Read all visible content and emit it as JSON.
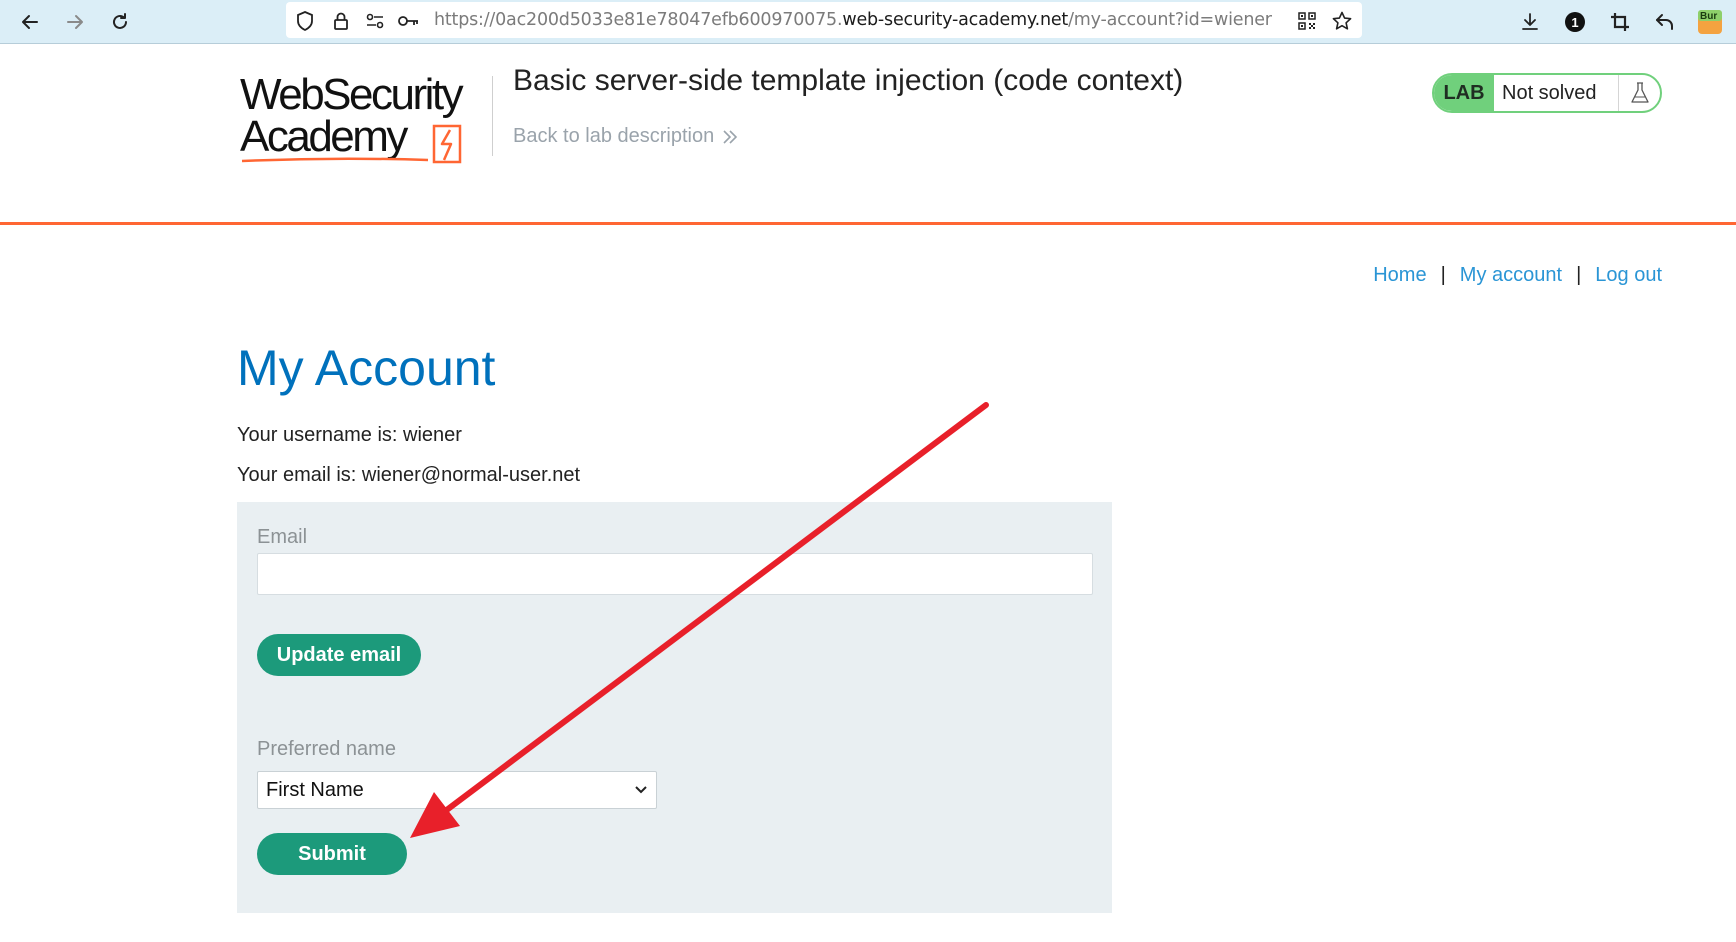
{
  "browser": {
    "url_prefix": "https://0ac200d5033e81e78047efb600970075.",
    "url_host": "web-security-academy.net",
    "url_path": "/my-account?id=wiener",
    "notification_count": "1",
    "extension_label": "Bur"
  },
  "header": {
    "logo_line1": "WebSecurity",
    "logo_line2": "Academy",
    "lab_title": "Basic server-side template injection (code context)",
    "back_link": "Back to lab description",
    "lab_tag": "LAB",
    "lab_status": "Not solved"
  },
  "topnav": {
    "home": "Home",
    "my_account": "My account",
    "log_out": "Log out",
    "separator": "|"
  },
  "main": {
    "heading": "My Account",
    "username_line": "Your username is: wiener",
    "email_line": "Your email is: wiener@normal-user.net",
    "email_label": "Email",
    "email_value": "",
    "update_email_button": "Update email",
    "preferred_name_label": "Preferred name",
    "preferred_name_selected": "First Name",
    "submit_button": "Submit"
  },
  "colors": {
    "heading_blue": "#0071bc",
    "link_blue": "#2a95d5",
    "button_green": "#1c9a7b",
    "lab_green": "#70d07c",
    "orange_rule": "#ff6633",
    "annotation_red": "#e8202a"
  }
}
